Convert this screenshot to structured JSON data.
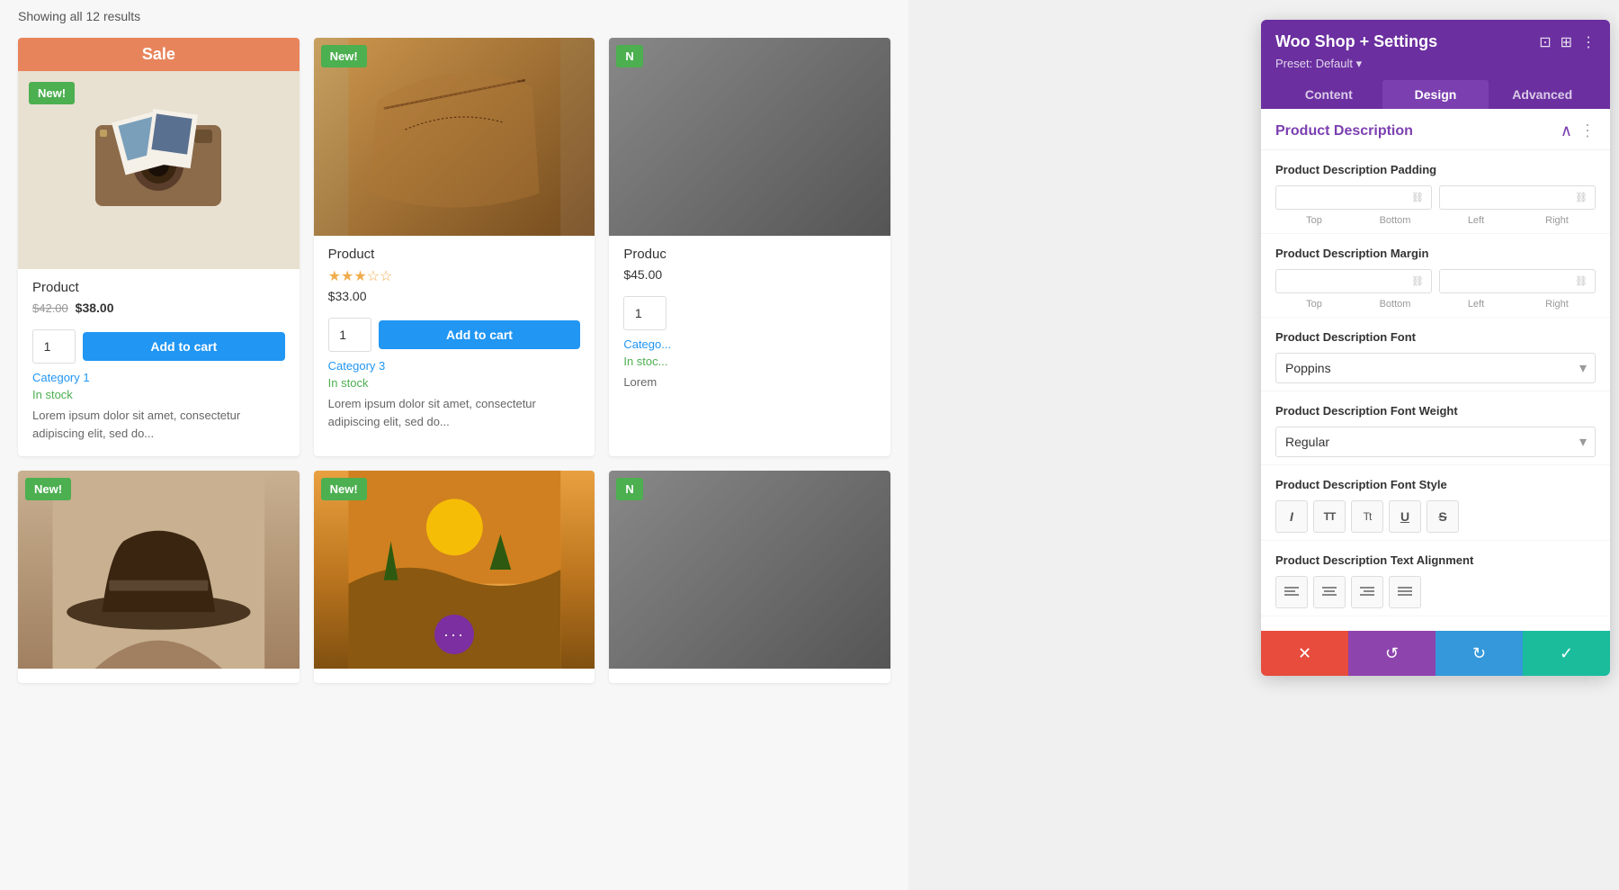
{
  "shop": {
    "results_count": "Showing all 12 results",
    "products": [
      {
        "id": 1,
        "has_sale_banner": true,
        "sale_banner_text": "Sale",
        "badge": "New!",
        "name": "Product",
        "old_price": "$42.00",
        "new_price": "$38.00",
        "has_stars": false,
        "add_to_cart_label": "Add to cart",
        "qty": "1",
        "category": "Category 1",
        "in_stock": "In stock",
        "description": "Lorem ipsum dolor sit amet, consectetur adipiscing elit, sed do..."
      },
      {
        "id": 2,
        "has_sale_banner": false,
        "badge": "New!",
        "name": "Product",
        "price": "$33.00",
        "has_stars": true,
        "stars_filled": 3,
        "stars_total": 5,
        "add_to_cart_label": "Add to cart",
        "qty": "1",
        "category": "Category 3",
        "in_stock": "In stock",
        "description": "Lorem ipsum dolor sit amet, consectetur adipiscing elit, sed do..."
      },
      {
        "id": 3,
        "has_sale_banner": false,
        "badge": "N",
        "name": "Produc",
        "price": "$45.00",
        "partial": true,
        "category": "Catego",
        "in_stock": "In stoc",
        "description": "Lorem"
      },
      {
        "id": 4,
        "has_sale_banner": false,
        "badge": "New!",
        "name": "",
        "price": "",
        "partial": false,
        "is_bottom": true
      },
      {
        "id": 5,
        "has_sale_banner": false,
        "badge": "New!",
        "name": "",
        "price": "",
        "partial": false,
        "is_bottom": true,
        "has_dots": true
      },
      {
        "id": 6,
        "badge": "N",
        "partial": true,
        "is_bottom": true
      }
    ]
  },
  "panel": {
    "title": "Woo Shop + Settings",
    "preset_label": "Preset: Default ▾",
    "tabs": [
      {
        "id": "content",
        "label": "Content",
        "active": false
      },
      {
        "id": "design",
        "label": "Design",
        "active": true
      },
      {
        "id": "advanced",
        "label": "Advanced",
        "active": false
      }
    ],
    "section_title": "Product Description",
    "settings": {
      "padding": {
        "label": "Product Description Padding",
        "fields": [
          "Top",
          "Bottom",
          "Left",
          "Right"
        ]
      },
      "margin": {
        "label": "Product Description Margin",
        "fields": [
          "Top",
          "Bottom",
          "Left",
          "Right"
        ]
      },
      "font": {
        "label": "Product Description Font",
        "value": "Poppins"
      },
      "font_weight": {
        "label": "Product Description Font Weight",
        "value": "Regular"
      },
      "font_style": {
        "label": "Product Description Font Style",
        "buttons": [
          {
            "id": "italic",
            "symbol": "I",
            "style": "italic"
          },
          {
            "id": "tt-caps",
            "symbol": "TT",
            "style": "normal"
          },
          {
            "id": "tt-lower",
            "symbol": "Tt",
            "style": "normal"
          },
          {
            "id": "underline",
            "symbol": "U",
            "style": "underline"
          },
          {
            "id": "strikethrough",
            "symbol": "S",
            "style": "strikethrough"
          }
        ]
      },
      "text_alignment": {
        "label": "Product Description Text Alignment",
        "buttons": [
          {
            "id": "left",
            "symbol": "≡",
            "title": "Left"
          },
          {
            "id": "center",
            "symbol": "≡",
            "title": "Center"
          },
          {
            "id": "right",
            "symbol": "≡",
            "title": "Right"
          },
          {
            "id": "justify",
            "symbol": "≡",
            "title": "Justify"
          }
        ]
      }
    },
    "actions": {
      "cancel": "✕",
      "undo": "↺",
      "redo": "↻",
      "save": "✓"
    }
  }
}
